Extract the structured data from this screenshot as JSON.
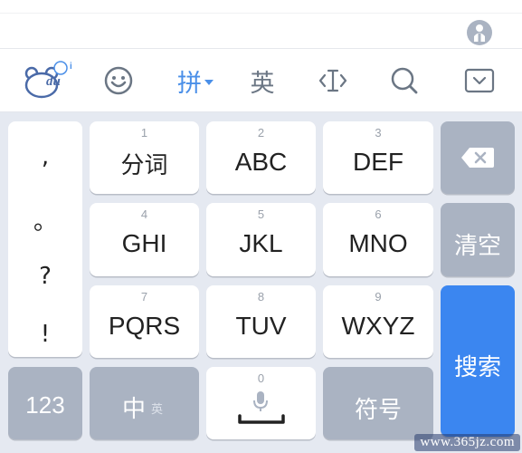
{
  "toolbar": {
    "logo_text": "du",
    "logo_badge": "i",
    "pinyin_label": "拼",
    "english_label": "英"
  },
  "keys": {
    "punct": [
      ",",
      "。",
      "?",
      "!"
    ],
    "k1": {
      "num": "1",
      "label": "分词"
    },
    "k2": {
      "num": "2",
      "label": "ABC"
    },
    "k3": {
      "num": "3",
      "label": "DEF"
    },
    "k4": {
      "num": "4",
      "label": "GHI"
    },
    "k5": {
      "num": "5",
      "label": "JKL"
    },
    "k6": {
      "num": "6",
      "label": "MNO"
    },
    "k7": {
      "num": "7",
      "label": "PQRS"
    },
    "k8": {
      "num": "8",
      "label": "TUV"
    },
    "k9": {
      "num": "9",
      "label": "WXYZ"
    },
    "k0": {
      "num": "0"
    },
    "clear": "清空",
    "search": "搜索",
    "numbers": "123",
    "lang_main": "中",
    "lang_sub": "英",
    "symbols": "符号"
  },
  "colors": {
    "accent": "#4a8fe8",
    "search_key": "#3b86f0",
    "function_key": "#aab3c2"
  },
  "watermark": "www.365jz.com"
}
